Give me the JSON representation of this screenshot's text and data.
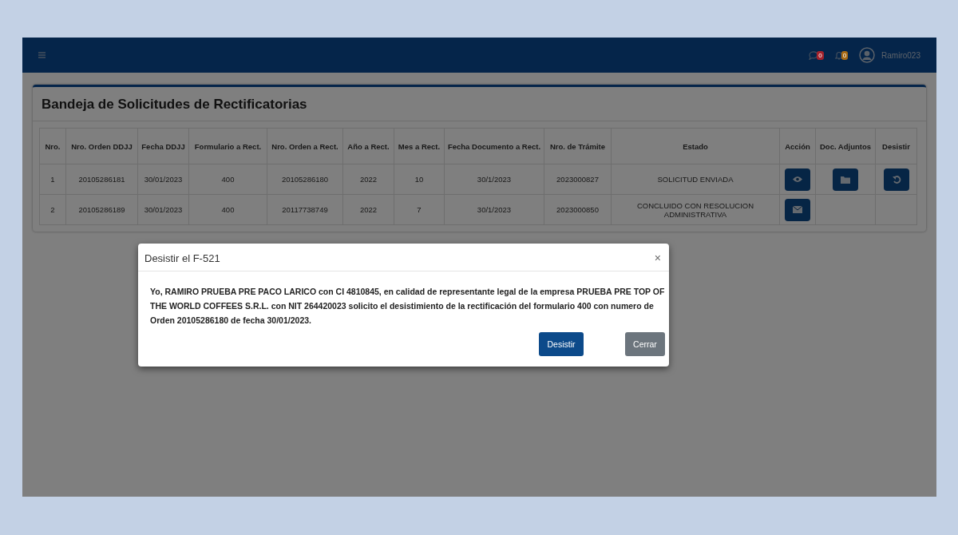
{
  "topbar": {
    "notifications": [
      {
        "kind": "chat",
        "count": "0",
        "color": "#a3222c"
      },
      {
        "kind": "bell",
        "count": "0",
        "color": "#a86a14"
      }
    ],
    "username": "Ramiro023"
  },
  "page_title": "Bandeja de Solicitudes de Rectificatorias",
  "table": {
    "columns": [
      "Nro.",
      "Nro. Orden DDJJ",
      "Fecha DDJJ",
      "Formulario a Rect.",
      "Nro. Orden a Rect.",
      "Año a Rect.",
      "Mes a Rect.",
      "Fecha Documento a Rect.",
      "Nro. de Trámite",
      "Estado",
      "Acción",
      "Doc. Adjuntos",
      "Desistir"
    ],
    "rows": [
      {
        "cells": [
          "1",
          "20105286181",
          "30/01/2023",
          "400",
          "20105286180",
          "2022",
          "10",
          "30/1/2023",
          "2023000827",
          "SOLICITUD ENVIADA"
        ],
        "accion": {
          "kind": "eye"
        },
        "adjuntos": {
          "kind": "folder"
        },
        "desistir": {
          "kind": "undo"
        }
      },
      {
        "cells": [
          "2",
          "20105286189",
          "30/01/2023",
          "400",
          "20117738749",
          "2022",
          "7",
          "30/1/2023",
          "2023000850",
          "CONCLUIDO CON RESOLUCION ADMINISTRATIVA"
        ],
        "accion": {
          "kind": "mail"
        }
      }
    ]
  },
  "modal": {
    "title": "Desistir el F-521",
    "close": "×",
    "message": "Yo, RAMIRO PRUEBA PRE PACO LARICO con CI 4810845, en calidad de representante legal de la empresa PRUEBA PRE TOP OF THE WORLD COFFEES S.R.L. con NIT 264420023 solicito el desistimiento de la rectificación del formulario 400 con numero de Orden 20105286180 de fecha 30/01/2023.",
    "buttons": [
      {
        "label": "Desistir",
        "kind": "primary"
      },
      {
        "label": "Cerrar",
        "kind": "secondary"
      }
    ]
  }
}
